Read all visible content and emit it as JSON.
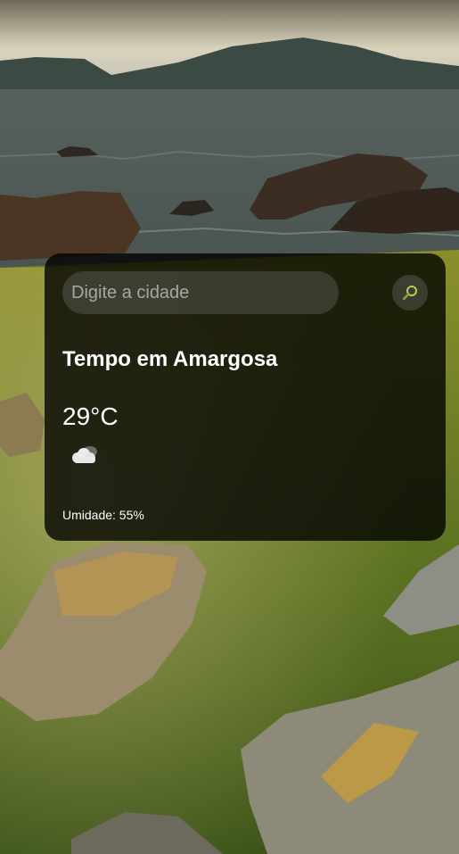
{
  "search": {
    "placeholder": "Digite a cidade",
    "value": ""
  },
  "weather": {
    "title": "Tempo em Amargosa",
    "temperature": "29°C",
    "icon": "cloud-icon",
    "humidity": "Umidade: 55%"
  },
  "colors": {
    "card_background": "#000000",
    "text": "#ffffff",
    "placeholder": "#a6a6a6"
  }
}
